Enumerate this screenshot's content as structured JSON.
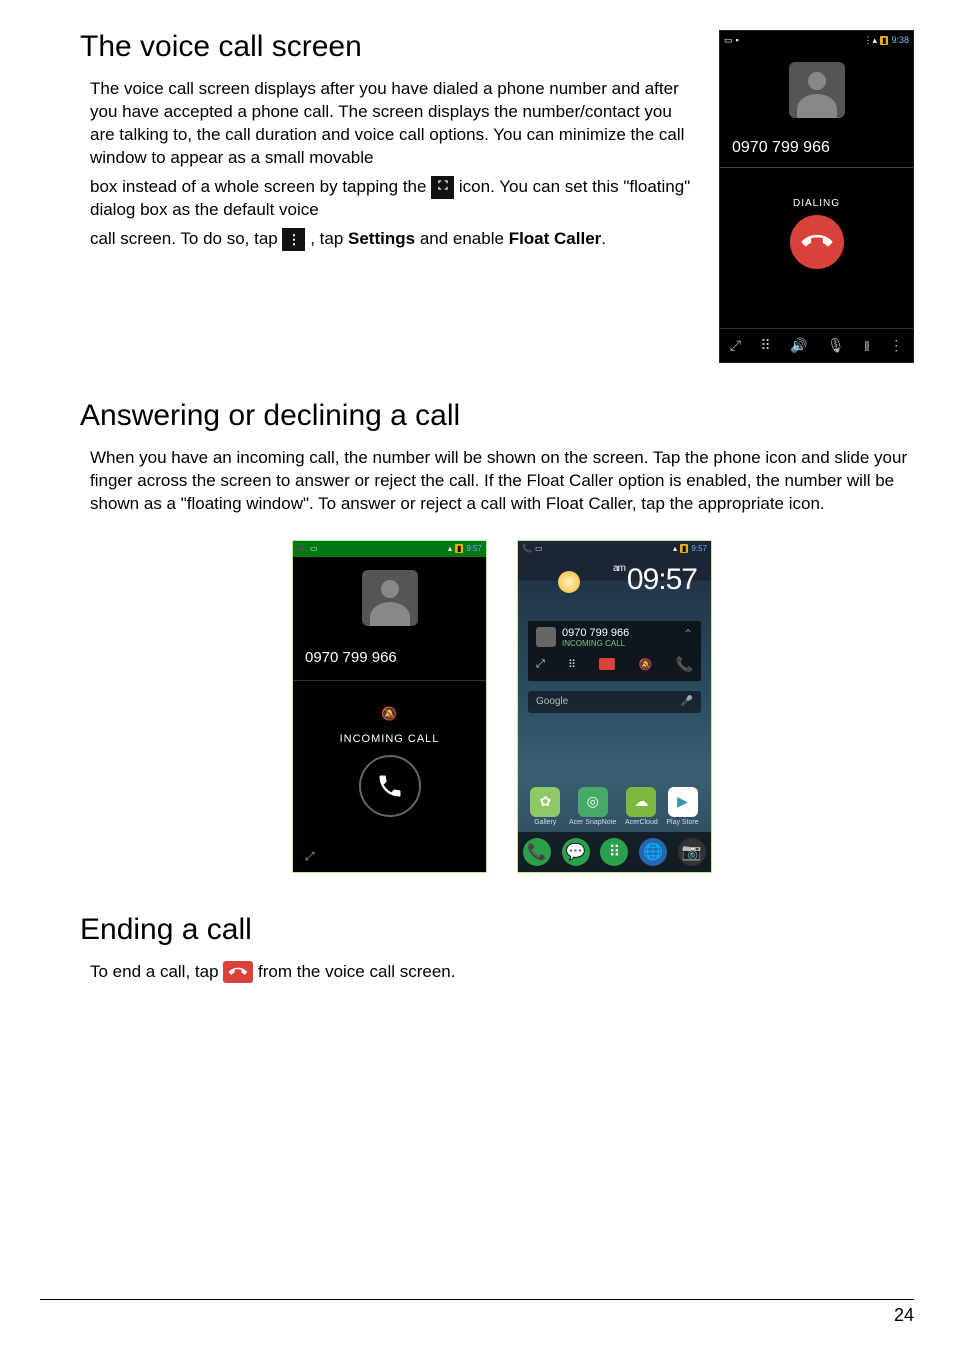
{
  "page_number": "24",
  "sections": {
    "voice": {
      "title": "The voice call screen",
      "p1": "The voice call screen displays after you have dialed a phone number and after you have accepted a phone call. The screen displays the number/contact you are talking to, the call duration and voice call options. You can minimize the call window to appear as a small movable",
      "p2a": "box instead of a whole screen by tapping the ",
      "p2b": " icon. You can set this \"floating\" dialog box as the default voice",
      "p3a": "call screen. To do so, tap ",
      "p3b": ", tap ",
      "p3_settings": "Settings",
      "p3c": " and enable ",
      "p3_float": "Float Caller",
      "p3d": "."
    },
    "answering": {
      "title": "Answering or declining a call",
      "p1": "When you have an incoming call, the number will be shown on the screen. Tap the phone icon and slide your finger across the screen to answer or reject the call. If the Float Caller option is enabled, the number will be shown as a \"floating window\". To answer or reject a call with Float Caller, tap the appropriate icon."
    },
    "ending": {
      "title": "Ending a call",
      "p1a": "To end a call, tap ",
      "p1b": " from the voice call screen."
    }
  },
  "phone_dialing": {
    "status_time": "9:38",
    "number": "0970 799 966",
    "dialing_label": "DIALING",
    "bottom_icons": [
      "minimize-icon",
      "dialpad-icon",
      "speaker-icon",
      "mute-icon",
      "pause-icon",
      "more-icon"
    ]
  },
  "phone_incoming": {
    "status_time": "9:57",
    "number": "0970 799 966",
    "incoming_label": "INCOMING CALL"
  },
  "phone_home": {
    "status_time": "9:57",
    "clock": "09:57",
    "clock_ampm": "am",
    "float_number": "0970 799 966",
    "float_sub": "INCOMING CALL",
    "search_placeholder": "Google",
    "apps": [
      {
        "label": "Gallery",
        "color": "#fff"
      },
      {
        "label": "Acer SnapNote",
        "color": "#862"
      },
      {
        "label": "AcerCloud",
        "color": "#7fb840"
      },
      {
        "label": "Play Store",
        "color": "#fff"
      }
    ]
  }
}
